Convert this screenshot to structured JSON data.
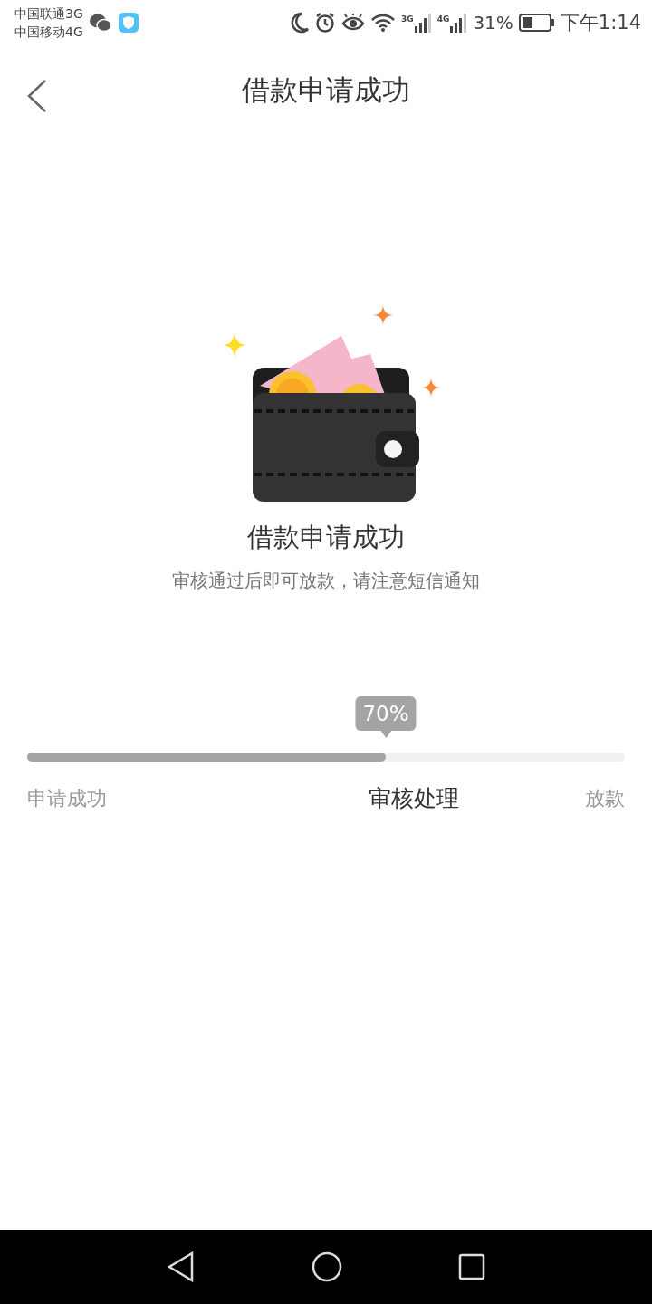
{
  "status_bar": {
    "carriers": [
      "中国联通3G",
      "中国移动4G"
    ],
    "signals": [
      {
        "network": "3G"
      },
      {
        "network": "4G"
      }
    ],
    "battery": "31%",
    "time": "下午1:14"
  },
  "header": {
    "title": "借款申请成功"
  },
  "result": {
    "title": "借款申请成功",
    "message": "审核通过后即可放款，请注意短信通知"
  },
  "progress": {
    "bubble": "70%",
    "level": 0.6,
    "steps": [
      {
        "label": "申请成功",
        "current": false
      },
      {
        "label": "审核处理",
        "current": true
      },
      {
        "label": "放款",
        "current": false
      }
    ]
  }
}
